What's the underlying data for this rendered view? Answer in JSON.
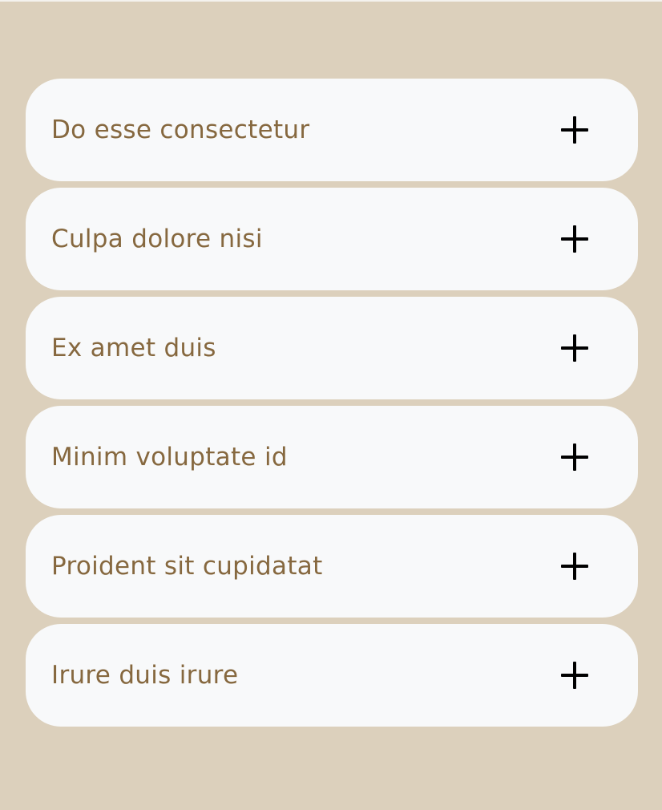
{
  "colors": {
    "background": "#dcd0bc",
    "card": "#f8f9fa",
    "question_text": "#86683f",
    "icon": "#000000"
  },
  "faq": {
    "items": [
      {
        "question": "Do esse consectetur",
        "icon": "plus-icon",
        "expanded": false
      },
      {
        "question": "Culpa dolore nisi",
        "icon": "plus-icon",
        "expanded": false
      },
      {
        "question": "Ex amet duis",
        "icon": "plus-icon",
        "expanded": false
      },
      {
        "question": "Minim voluptate id",
        "icon": "plus-icon",
        "expanded": false
      },
      {
        "question": "Proident sit cupidatat",
        "icon": "plus-icon",
        "expanded": false
      },
      {
        "question": "Irure duis irure",
        "icon": "plus-icon",
        "expanded": false
      }
    ]
  }
}
